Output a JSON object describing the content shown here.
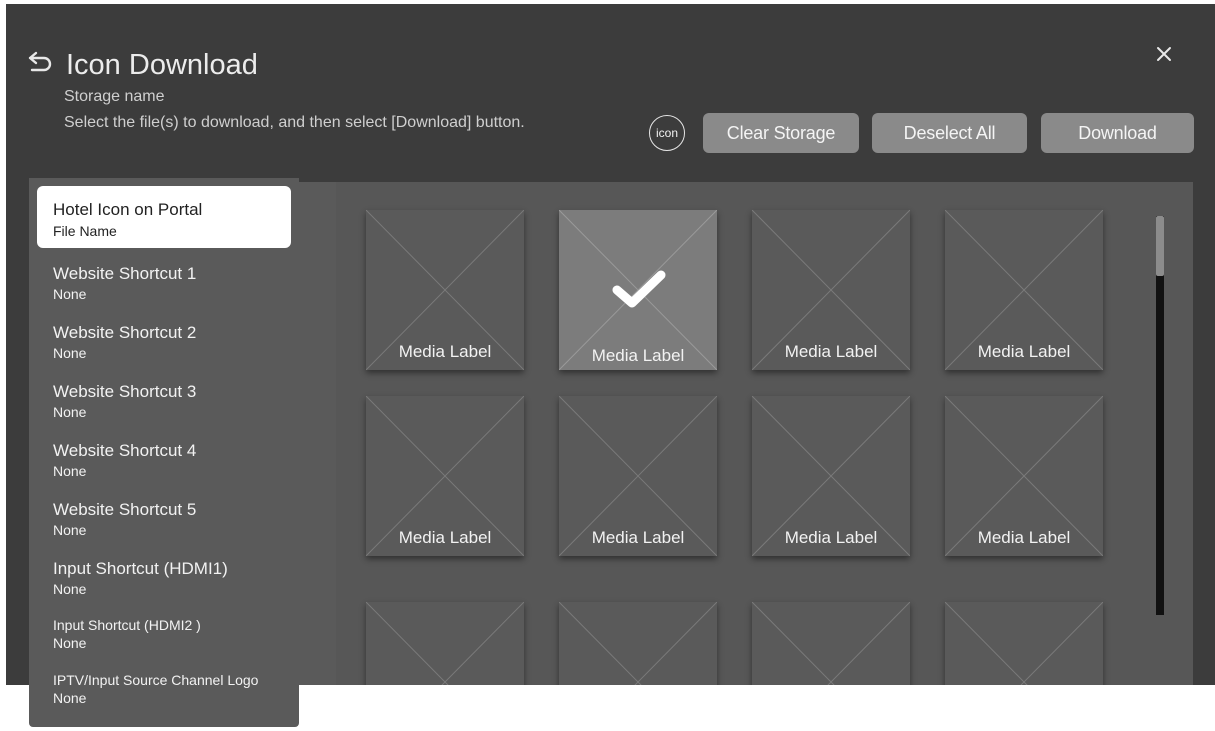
{
  "header": {
    "title": "Icon Download",
    "storage_name": "Storage name",
    "instruction": "Select the file(s) to download, and then select [Download] button.",
    "icon_badge": "icon"
  },
  "toolbar": {
    "clear_storage": "Clear Storage",
    "deselect_all": "Deselect All",
    "download": "Download"
  },
  "sidebar": {
    "items": [
      {
        "name": "Hotel Icon on Portal",
        "value": "File Name",
        "selected": true
      },
      {
        "name": "Website Shortcut 1",
        "value": "None"
      },
      {
        "name": "Website Shortcut 2",
        "value": "None"
      },
      {
        "name": "Website Shortcut 3",
        "value": "None"
      },
      {
        "name": "Website Shortcut 4",
        "value": "None"
      },
      {
        "name": "Website Shortcut 5",
        "value": "None"
      },
      {
        "name": "Input Shortcut (HDMI1)",
        "value": "None"
      },
      {
        "name": "Input Shortcut (HDMI2 )",
        "value": "None"
      },
      {
        "name": "IPTV/Input Source Channel Logo",
        "value": "None"
      }
    ]
  },
  "grid": {
    "tiles": [
      {
        "label": "Media Label",
        "selected": false
      },
      {
        "label": "Media Label",
        "selected": true
      },
      {
        "label": "Media Label",
        "selected": false
      },
      {
        "label": "Media Label",
        "selected": false
      },
      {
        "label": "Media Label",
        "selected": false
      },
      {
        "label": "Media Label",
        "selected": false
      },
      {
        "label": "Media Label",
        "selected": false
      },
      {
        "label": "Media Label",
        "selected": false
      },
      {
        "label": "",
        "selected": false
      },
      {
        "label": "",
        "selected": false
      },
      {
        "label": "",
        "selected": false
      },
      {
        "label": "",
        "selected": false
      }
    ]
  },
  "icons": {
    "back": "back-arrow-icon",
    "close": "close-icon",
    "selected": "checkmark-icon",
    "placeholder": "image-placeholder-icon"
  },
  "colors": {
    "panel_bg": "#3c3c3c",
    "content_bg": "#5a5a5a",
    "button_bg": "#8a8a8a",
    "selected_tile_bg": "#7c7c7c",
    "active_item_bg": "#ffffff",
    "text": "#f2f2f2"
  }
}
